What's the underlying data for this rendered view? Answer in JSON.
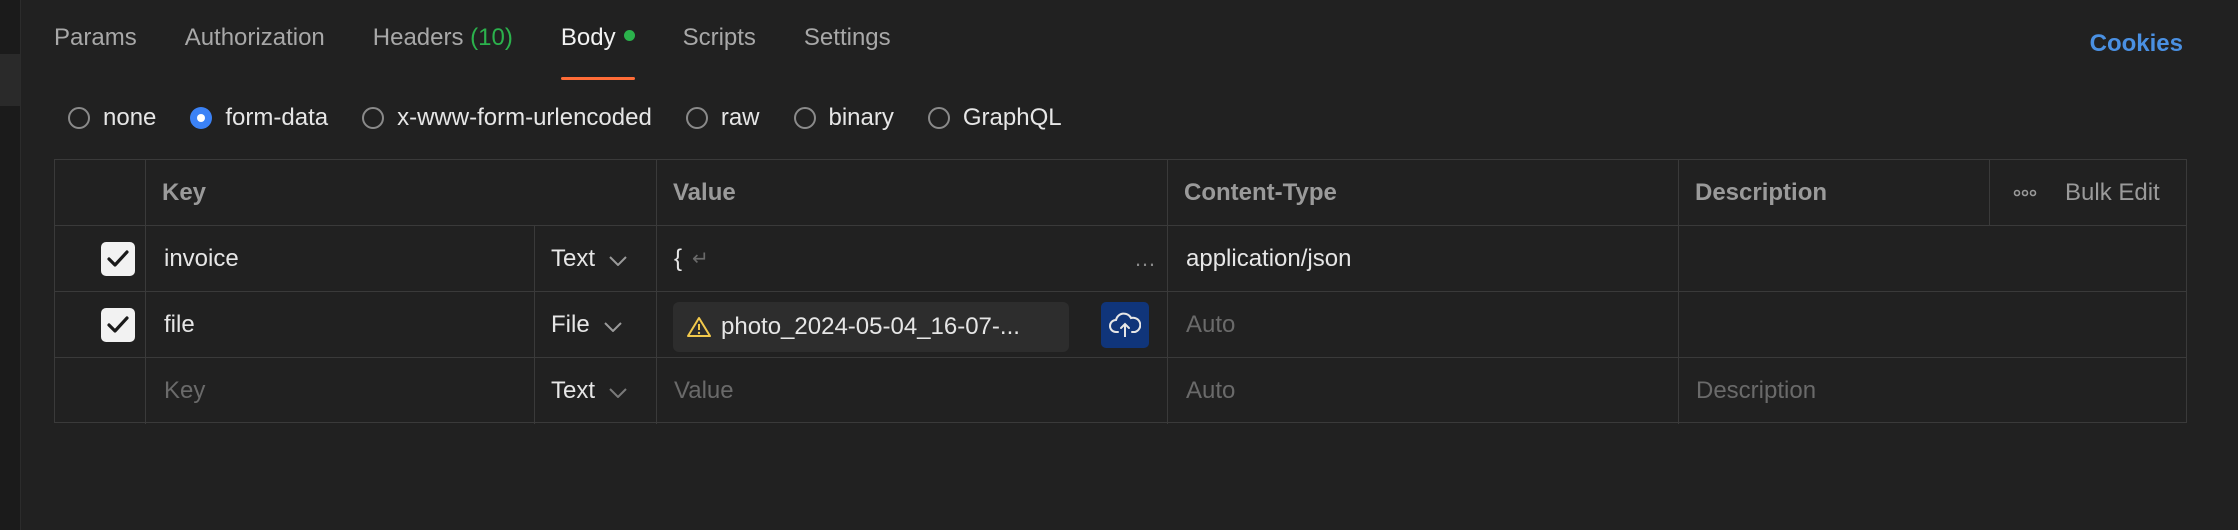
{
  "tabs": [
    {
      "label": "Params"
    },
    {
      "label": "Authorization"
    },
    {
      "label": "Headers",
      "count": "(10)"
    },
    {
      "label": "Body"
    },
    {
      "label": "Scripts"
    },
    {
      "label": "Settings"
    }
  ],
  "cookies_label": "Cookies",
  "body_types": [
    "none",
    "form-data",
    "x-www-form-urlencoded",
    "raw",
    "binary",
    "GraphQL"
  ],
  "selected_body_type": "form-data",
  "table": {
    "headers": {
      "key": "Key",
      "value": "Value",
      "content_type": "Content-Type",
      "description": "Description",
      "bulk_edit": "Bulk Edit"
    },
    "rows": [
      {
        "checked": true,
        "key": "invoice",
        "type": "Text",
        "value": "{",
        "content_type": "application/json",
        "description": ""
      },
      {
        "checked": true,
        "key": "file",
        "type": "File",
        "value": "photo_2024-05-04_16-07-...",
        "content_type": "Auto",
        "description": ""
      }
    ],
    "new_row": {
      "key_placeholder": "Key",
      "type": "Text",
      "value_placeholder": "Value",
      "content_type_placeholder": "Auto",
      "description_placeholder": "Description"
    }
  },
  "colors": {
    "accent_tab": "#ff6c37",
    "count_green": "#2bb24c",
    "link_blue": "#4a90e2",
    "radio_blue": "#3b82f6",
    "upload_bg": "#10357a"
  }
}
